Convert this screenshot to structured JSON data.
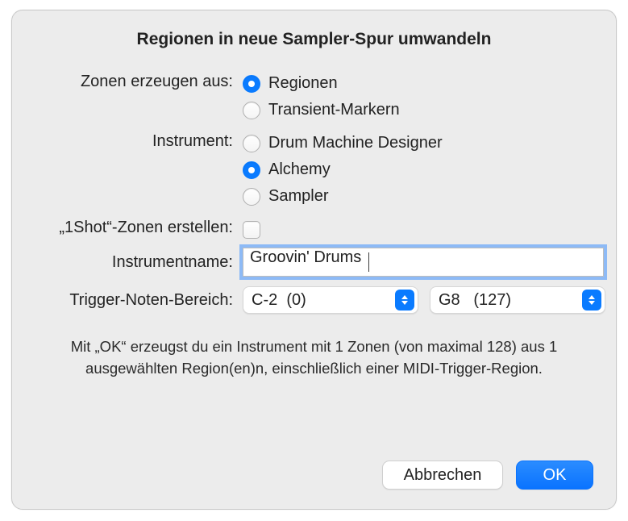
{
  "title": "Regionen in neue Sampler-Spur umwandeln",
  "labels": {
    "zones_from": "Zonen erzeugen aus:",
    "instrument": "Instrument:",
    "oneshot": "„1Shot“-Zonen erstellen:",
    "instrument_name": "Instrumentname:",
    "trigger_range": "Trigger-Noten-Bereich:"
  },
  "zones_from_options": {
    "regions": "Regionen",
    "transients": "Transient-Markern"
  },
  "zones_from_selected": "regions",
  "instrument_options": {
    "dmd": "Drum Machine Designer",
    "alchemy": "Alchemy",
    "sampler": "Sampler"
  },
  "instrument_selected": "alchemy",
  "oneshot_checked": false,
  "instrument_name_value": "Groovin' Drums",
  "trigger_range": {
    "low": "C-2  (0)",
    "high": "G8   (127)"
  },
  "info_text": "Mit „OK“ erzeugst du ein Instrument mit 1 Zonen (von maximal 128) aus 1 ausgewählten Region(en)n, einschließlich einer MIDI-Trigger-Region.",
  "buttons": {
    "cancel": "Abbrechen",
    "ok": "OK"
  }
}
